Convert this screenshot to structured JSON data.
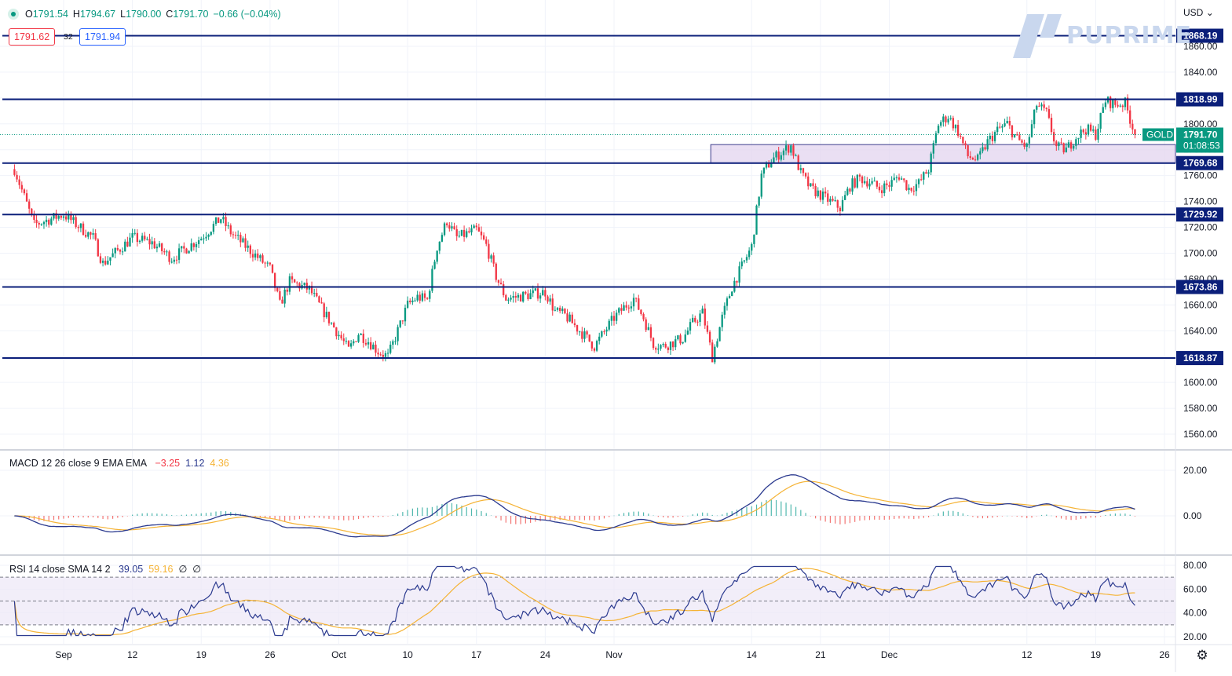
{
  "legend": {
    "o_key": "O",
    "o_val": "1791.54",
    "h_key": "H",
    "h_val": "1794.67",
    "l_key": "L",
    "l_val": "1790.00",
    "c_key": "C",
    "c_val": "1791.70",
    "change": "−0.66 (−0.04%)"
  },
  "trade": {
    "sell": "1791.62",
    "spread": "32",
    "buy": "1791.94"
  },
  "currency_label": "USD",
  "watermark": "PUPRIME",
  "symbol_label": "GOLD",
  "last_price": "1791.70",
  "countdown": "01:08:53",
  "macd_legend": {
    "name": "MACD 12 26 close 9 EMA EMA",
    "v1": "−3.25",
    "v2": "1.12",
    "v3": "4.36"
  },
  "rsi_legend": {
    "name": "RSI 14 close SMA 14 2",
    "v1": "39.05",
    "v2": "59.16",
    "v3": "∅",
    "v4": "∅"
  },
  "colors": {
    "up": "#089981",
    "down": "#f23645",
    "level_line": "#0b1f7a",
    "zone_fill": "#e3d4ef",
    "macd_line": "#2b3a8f",
    "signal_line": "#f5b335",
    "rsi_line": "#2b3a8f",
    "rsi_sma": "#f5b335"
  },
  "icons": {
    "settings": "gear-icon"
  },
  "chart_data": [
    {
      "type": "candlestick",
      "title": "",
      "x_tick_labels": [
        "Sep",
        "12",
        "19",
        "26",
        "Oct",
        "10",
        "17",
        "24",
        "Nov",
        "14",
        "21",
        "Dec",
        "12",
        "19",
        "26"
      ],
      "y_tick_labels": [
        "1860.00",
        "1840.00",
        "1820.00",
        "1800.00",
        "1780.00",
        "1760.00",
        "1740.00",
        "1720.00",
        "1700.00",
        "1680.00",
        "1660.00",
        "1640.00",
        "1620.00",
        "1600.00",
        "1580.00",
        "1560.00"
      ],
      "ylim": [
        1550,
        1875
      ],
      "horizontal_levels": [
        {
          "value": 1868.19,
          "label": "1868.19"
        },
        {
          "value": 1818.99,
          "label": "1818.99"
        },
        {
          "value": 1769.68,
          "label": "1769.68"
        },
        {
          "value": 1729.92,
          "label": "1729.92"
        },
        {
          "value": 1673.86,
          "label": "1673.86"
        },
        {
          "value": 1618.87,
          "label": "1618.87"
        }
      ],
      "zone": {
        "from": 1769.68,
        "to": 1784.0,
        "start": "Nov 10"
      },
      "last_price": 1791.7,
      "close_anchors": [
        [
          "Aug 31",
          1765
        ],
        [
          "Sep 2",
          1722
        ],
        [
          "Sep 5",
          1730
        ],
        [
          "Sep 8",
          1712
        ],
        [
          "Sep 9",
          1692
        ],
        [
          "Sep 12",
          1712
        ],
        [
          "Sep 14",
          1708
        ],
        [
          "Sep 16",
          1696
        ],
        [
          "Sep 19",
          1712
        ],
        [
          "Sep 21",
          1727
        ],
        [
          "Sep 22",
          1716
        ],
        [
          "Sep 26",
          1688
        ],
        [
          "Sep 27",
          1660
        ],
        [
          "Sep 28",
          1678
        ],
        [
          "Sep 30",
          1672
        ],
        [
          "Oct 1",
          1660
        ],
        [
          "Oct 3",
          1637
        ],
        [
          "Oct 4",
          1625
        ],
        [
          "Oct 5",
          1638
        ],
        [
          "Oct 6",
          1632
        ],
        [
          "Oct 7",
          1624
        ],
        [
          "Oct 8",
          1620
        ],
        [
          "Oct 10",
          1660
        ],
        [
          "Oct 11",
          1666
        ],
        [
          "Oct 12",
          1664
        ],
        [
          "Oct 13",
          1705
        ],
        [
          "Oct 14",
          1725
        ],
        [
          "Oct 15",
          1712
        ],
        [
          "Oct 17",
          1718
        ],
        [
          "Oct 18",
          1706
        ],
        [
          "Oct 19",
          1682
        ],
        [
          "Oct 20",
          1665
        ],
        [
          "Oct 21",
          1666
        ],
        [
          "Oct 24",
          1670
        ],
        [
          "Oct 25",
          1655
        ],
        [
          "Oct 26",
          1652
        ],
        [
          "Oct 27",
          1644
        ],
        [
          "Oct 28",
          1636
        ],
        [
          "Oct 29",
          1628
        ],
        [
          "Oct 31",
          1650
        ],
        [
          "Nov 1",
          1658
        ],
        [
          "Nov 2",
          1665
        ],
        [
          "Nov 3",
          1650
        ],
        [
          "Nov 4",
          1630
        ],
        [
          "Nov 5",
          1628
        ],
        [
          "Nov 7",
          1634
        ],
        [
          "Nov 8",
          1646
        ],
        [
          "Nov 9",
          1654
        ],
        [
          "Nov 10",
          1620
        ],
        [
          "Nov 11",
          1650
        ],
        [
          "Nov 12",
          1674
        ],
        [
          "Nov 14",
          1705
        ],
        [
          "Nov 15",
          1760
        ],
        [
          "Nov 16",
          1772
        ],
        [
          "Nov 17",
          1778
        ],
        [
          "Nov 18",
          1783
        ],
        [
          "Nov 19",
          1762
        ],
        [
          "Nov 20",
          1750
        ],
        [
          "Nov 21",
          1745
        ],
        [
          "Nov 23",
          1735
        ],
        [
          "Nov 24",
          1752
        ],
        [
          "Nov 25",
          1758
        ],
        [
          "Nov 26",
          1755
        ],
        [
          "Nov 27",
          1750
        ],
        [
          "Nov 28",
          1753
        ],
        [
          "Nov 29",
          1760
        ],
        [
          "Nov 30",
          1750
        ],
        [
          "Dec 1",
          1754
        ],
        [
          "Dec 2",
          1765
        ],
        [
          "Dec 3",
          1800
        ],
        [
          "Dec 4",
          1806
        ],
        [
          "Dec 5",
          1794
        ],
        [
          "Dec 6",
          1775
        ],
        [
          "Dec 7",
          1772
        ],
        [
          "Dec 8",
          1786
        ],
        [
          "Dec 9",
          1795
        ],
        [
          "Dec 10",
          1800
        ],
        [
          "Dec 11",
          1788
        ],
        [
          "Dec 12",
          1782
        ],
        [
          "Dec 13",
          1815
        ],
        [
          "Dec 14",
          1808
        ],
        [
          "Dec 15",
          1782
        ],
        [
          "Dec 16",
          1780
        ],
        [
          "Dec 17",
          1790
        ],
        [
          "Dec 18",
          1796
        ],
        [
          "Dec 19",
          1792
        ],
        [
          "Dec 20",
          1818
        ],
        [
          "Dec 21",
          1815
        ],
        [
          "Dec 22",
          1816
        ],
        [
          "Dec 23",
          1791.7
        ]
      ]
    },
    {
      "type": "line",
      "title": "MACD 12 26 close 9 EMA EMA",
      "y_tick_labels": [
        "20.00",
        "0.00"
      ],
      "ylim": [
        -12,
        27
      ],
      "series": [
        {
          "name": "MACD"
        },
        {
          "name": "Signal"
        },
        {
          "name": "Histogram"
        }
      ],
      "last_values": {
        "histogram": -3.25,
        "macd": 1.12,
        "signal": 4.36
      }
    },
    {
      "type": "line",
      "title": "RSI 14 close SMA 14 2",
      "y_tick_labels": [
        "80.00",
        "60.00",
        "40.00",
        "20.00"
      ],
      "ylim": [
        15,
        82
      ],
      "bands": [
        70,
        50,
        30
      ],
      "series": [
        {
          "name": "RSI"
        },
        {
          "name": "SMA"
        }
      ],
      "last_values": {
        "rsi": 39.05,
        "sma": 59.16
      }
    }
  ]
}
